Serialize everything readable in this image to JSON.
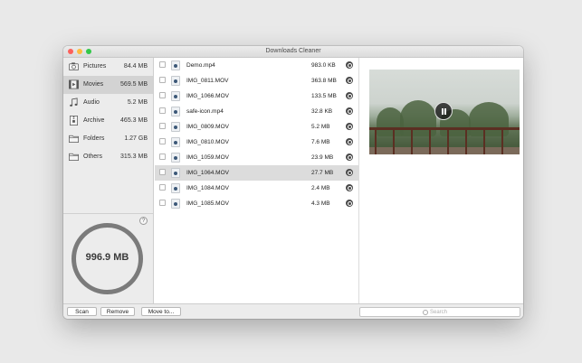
{
  "window": {
    "title": "Downloads Cleaner"
  },
  "sidebar": {
    "categories": [
      {
        "label": "Pictures",
        "size": "84.4 MB",
        "icon": "camera-icon"
      },
      {
        "label": "Movies",
        "size": "569.5 MB",
        "icon": "film-icon"
      },
      {
        "label": "Audio",
        "size": "5.2 MB",
        "icon": "music-note-icon"
      },
      {
        "label": "Archive",
        "size": "465.3 MB",
        "icon": "archive-icon"
      },
      {
        "label": "Folders",
        "size": "1.27 GB",
        "icon": "folder-icon"
      },
      {
        "label": "Others",
        "size": "315.3 MB",
        "icon": "folder-icon"
      }
    ],
    "help_label": "?",
    "total_size": "996.9 MB"
  },
  "files": [
    {
      "name": "Demo.mp4",
      "size": "983.0 KB"
    },
    {
      "name": "IMG_0811.MOV",
      "size": "363.8 MB"
    },
    {
      "name": "IMG_1066.MOV",
      "size": "133.5 MB"
    },
    {
      "name": "safe-icon.mp4",
      "size": "32.8 KB"
    },
    {
      "name": "IMG_0809.MOV",
      "size": "5.2 MB"
    },
    {
      "name": "IMG_0810.MOV",
      "size": "7.6 MB"
    },
    {
      "name": "IMG_1059.MOV",
      "size": "23.9 MB"
    },
    {
      "name": "IMG_1064.MOV",
      "size": "27.7 MB"
    },
    {
      "name": "IMG_1084.MOV",
      "size": "2.4 MB"
    },
    {
      "name": "IMG_1085.MOV",
      "size": "4.3 MB"
    }
  ],
  "toolbar": {
    "scan_label": "Scan",
    "remove_label": "Remove",
    "move_label": "Move to..."
  },
  "search": {
    "placeholder": "Search"
  }
}
